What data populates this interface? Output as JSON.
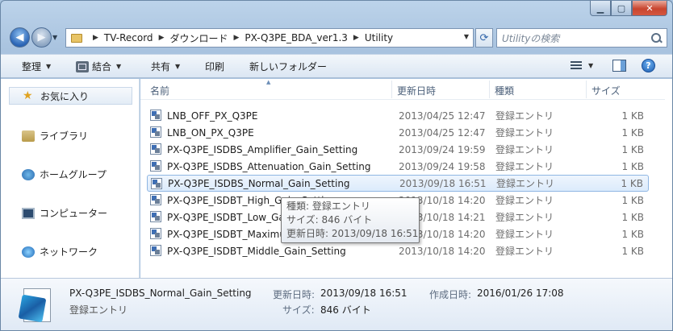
{
  "window": {
    "caption": {
      "minimize": "▁",
      "maximize": "▢",
      "close": "✕"
    }
  },
  "nav": {
    "breadcrumbs": [
      "TV-Record",
      "ダウンロード",
      "PX-Q3PE_BDA_ver1.3",
      "Utility"
    ],
    "search_placeholder": "Utilityの検索"
  },
  "toolbar": {
    "organize": "整理",
    "combine": "結合",
    "share": "共有",
    "print": "印刷",
    "new_folder": "新しいフォルダー"
  },
  "sidebar": {
    "favorites": "お気に入り",
    "libraries": "ライブラリ",
    "homegroup": "ホームグループ",
    "computer": "コンピューター",
    "network": "ネットワーク"
  },
  "columns": {
    "name": "名前",
    "date": "更新日時",
    "type": "種類",
    "size": "サイズ"
  },
  "files": [
    {
      "name": "LNB_OFF_PX_Q3PE",
      "date": "2013/04/25 12:47",
      "type": "登録エントリ",
      "size": "1 KB"
    },
    {
      "name": "LNB_ON_PX_Q3PE",
      "date": "2013/04/25 12:47",
      "type": "登録エントリ",
      "size": "1 KB"
    },
    {
      "name": "PX-Q3PE_ISDBS_Amplifier_Gain_Setting",
      "date": "2013/09/24 19:59",
      "type": "登録エントリ",
      "size": "1 KB"
    },
    {
      "name": "PX-Q3PE_ISDBS_Attenuation_Gain_Setting",
      "date": "2013/09/24 19:58",
      "type": "登録エントリ",
      "size": "1 KB"
    },
    {
      "name": "PX-Q3PE_ISDBS_Normal_Gain_Setting",
      "date": "2013/09/18 16:51",
      "type": "登録エントリ",
      "size": "1 KB"
    },
    {
      "name": "PX-Q3PE_ISDBT_High_Gain_Setting",
      "date": "2013/10/18 14:20",
      "type": "登録エントリ",
      "size": "1 KB"
    },
    {
      "name": "PX-Q3PE_ISDBT_Low_Gain_Setting",
      "date": "2013/10/18 14:21",
      "type": "登録エントリ",
      "size": "1 KB"
    },
    {
      "name": "PX-Q3PE_ISDBT_Maximum_Gain_Setting",
      "date": "2013/10/18 14:20",
      "type": "登録エントリ",
      "size": "1 KB"
    },
    {
      "name": "PX-Q3PE_ISDBT_Middle_Gain_Setting",
      "date": "2013/10/18 14:20",
      "type": "登録エントリ",
      "size": "1 KB"
    }
  ],
  "tooltip": {
    "type": "種類: 登録エントリ",
    "size": "サイズ: 846 バイト",
    "date": "更新日時: 2013/09/18 16:51"
  },
  "details": {
    "name": "PX-Q3PE_ISDBS_Normal_Gain_Setting",
    "type": "登録エントリ",
    "modified_label": "更新日時:",
    "modified_value": "2013/09/18 16:51",
    "created_label": "作成日時:",
    "created_value": "2016/01/26 17:08",
    "size_label": "サイズ:",
    "size_value": "846 バイト"
  }
}
